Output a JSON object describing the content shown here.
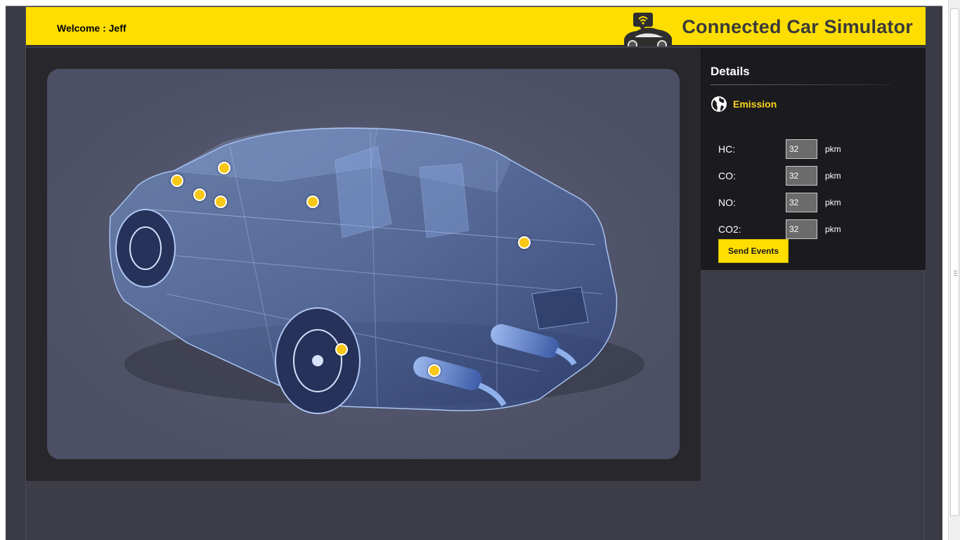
{
  "header": {
    "welcome_text": "Welcome : Jeff",
    "brand_title": "Connected Car Simulator",
    "background_color": "#fede00",
    "logo_icon": "connected-car-wifi-logo"
  },
  "car_view": {
    "panel_color": "#4d5064",
    "sensor_color": "#f9c715",
    "sensor_count": 9
  },
  "details": {
    "title": "Details",
    "section_icon": "globe-icon",
    "section_label": "Emission",
    "fields": [
      {
        "label": "HC:",
        "value": "32",
        "unit": "pkm"
      },
      {
        "label": "CO:",
        "value": "32",
        "unit": "pkm"
      },
      {
        "label": "NO:",
        "value": "32",
        "unit": "pkm"
      },
      {
        "label": "CO2:",
        "value": "32",
        "unit": "pkm"
      }
    ],
    "send_button_label": "Send Events"
  }
}
